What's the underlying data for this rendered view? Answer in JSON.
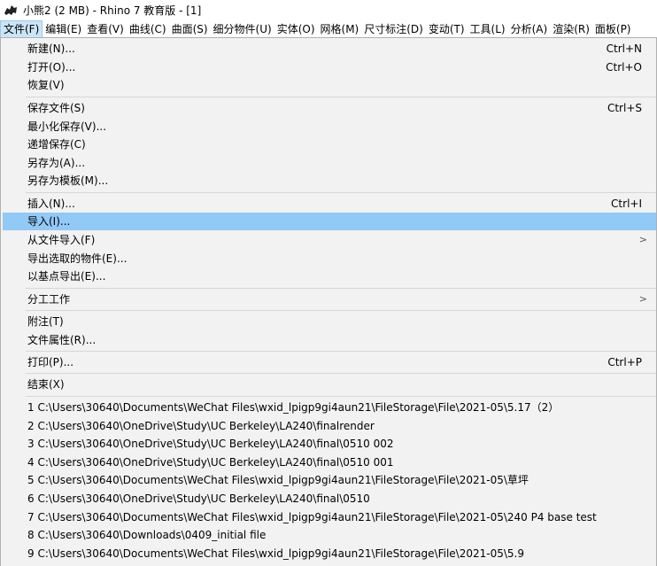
{
  "window": {
    "title": "小熊2 (2 MB) - Rhino 7 教育版 - [1]"
  },
  "menubar": [
    {
      "label": "文件(F)"
    },
    {
      "label": "编辑(E)"
    },
    {
      "label": "查看(V)"
    },
    {
      "label": "曲线(C)"
    },
    {
      "label": "曲面(S)"
    },
    {
      "label": "细分物件(U)"
    },
    {
      "label": "实体(O)"
    },
    {
      "label": "网格(M)"
    },
    {
      "label": "尺寸标注(D)"
    },
    {
      "label": "变动(T)"
    },
    {
      "label": "工具(L)"
    },
    {
      "label": "分析(A)"
    },
    {
      "label": "渲染(R)"
    },
    {
      "label": "面板(P)"
    }
  ],
  "file_menu": {
    "new": {
      "label": "新建(N)...",
      "shortcut": "Ctrl+N"
    },
    "open": {
      "label": "打开(O)...",
      "shortcut": "Ctrl+O"
    },
    "revert": {
      "label": "恢复(V)"
    },
    "save": {
      "label": "保存文件(S)",
      "shortcut": "Ctrl+S"
    },
    "save_small": {
      "label": "最小化保存(V)..."
    },
    "incremental_save": {
      "label": "递增保存(C)"
    },
    "save_as": {
      "label": "另存为(A)..."
    },
    "save_as_template": {
      "label": "另存为模板(M)..."
    },
    "insert": {
      "label": "插入(N)...",
      "shortcut": "Ctrl+I"
    },
    "import": {
      "label": "导入(I)..."
    },
    "import_from_file": {
      "label": "从文件导入(F)"
    },
    "export_selected": {
      "label": "导出选取的物件(E)..."
    },
    "export_with_origin": {
      "label": "以基点导出(E)..."
    },
    "worksession": {
      "label": "分工工作"
    },
    "notes": {
      "label": "附注(T)"
    },
    "properties": {
      "label": "文件属性(R)..."
    },
    "print": {
      "label": "打印(P)...",
      "shortcut": "Ctrl+P"
    },
    "exit": {
      "label": "结束(X)"
    },
    "recent_files": [
      "1 C:\\Users\\30640\\Documents\\WeChat Files\\wxid_lpigp9gi4aun21\\FileStorage\\File\\2021-05\\5.17（2）",
      "2 C:\\Users\\30640\\OneDrive\\Study\\UC Berkeley\\LA240\\finalrender",
      "3 C:\\Users\\30640\\OneDrive\\Study\\UC Berkeley\\LA240\\final\\0510 002",
      "4 C:\\Users\\30640\\OneDrive\\Study\\UC Berkeley\\LA240\\final\\0510 001",
      "5 C:\\Users\\30640\\Documents\\WeChat Files\\wxid_lpigp9gi4aun21\\FileStorage\\File\\2021-05\\草坪",
      "6 C:\\Users\\30640\\OneDrive\\Study\\UC Berkeley\\LA240\\final\\0510",
      "7 C:\\Users\\30640\\Documents\\WeChat Files\\wxid_lpigp9gi4aun21\\FileStorage\\File\\2021-05\\240 P4 base  test",
      "8 C:\\Users\\30640\\Downloads\\0409_initial file",
      "9 C:\\Users\\30640\\Documents\\WeChat Files\\wxid_lpigp9gi4aun21\\FileStorage\\File\\2021-05\\5.9"
    ]
  },
  "icons": {
    "app": "rhino-app-icon",
    "submenu": "chevron-right-icon"
  },
  "colors": {
    "highlight": "#91c9f7",
    "menu_bg": "#f2f2f2",
    "active_menu": "#cce4f7"
  }
}
